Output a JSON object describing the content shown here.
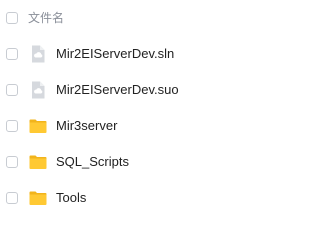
{
  "header": {
    "column_label": "文件名"
  },
  "files": [
    {
      "name": "Mir2EIServerDev.sln",
      "icon": "generic-file-icon"
    },
    {
      "name": "Mir2EIServerDev.suo",
      "icon": "generic-file-icon"
    },
    {
      "name": "Mir3server",
      "icon": "folder-icon"
    },
    {
      "name": "SQL_Scripts",
      "icon": "folder-icon"
    },
    {
      "name": "Tools",
      "icon": "folder-icon"
    }
  ],
  "colors": {
    "folder": "#FFC933",
    "folder_tab": "#F2B41C",
    "file_icon": "#C9CDD3",
    "checkbox_border": "#C8CCD2"
  }
}
